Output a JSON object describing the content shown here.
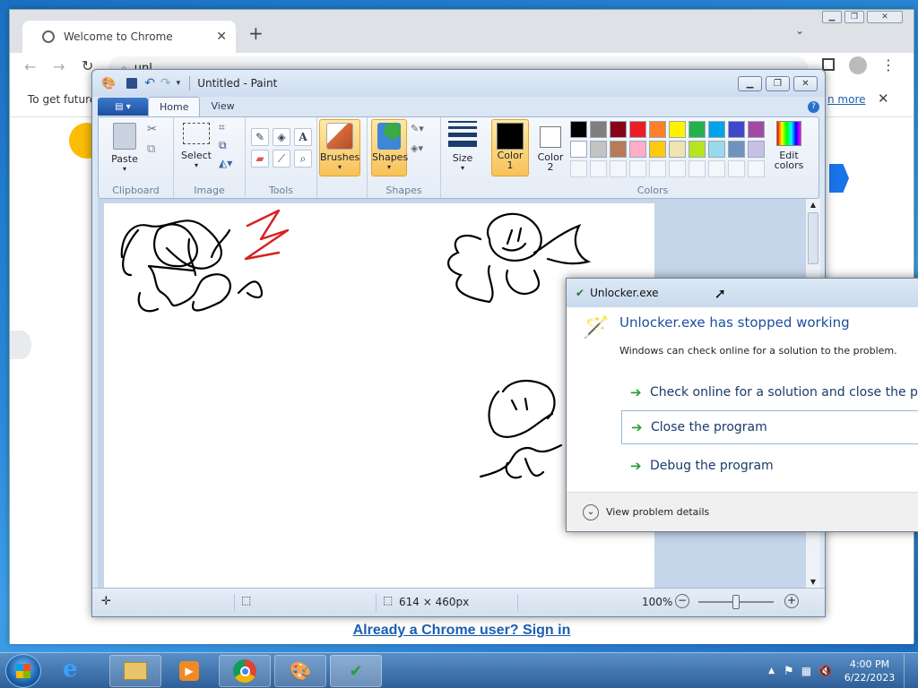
{
  "chrome": {
    "tab_title": "Welcome to Chrome",
    "omnibox_text": "unl",
    "info_text": "To get future",
    "info_link": "n more",
    "signin_link": "Already a Chrome user? Sign in"
  },
  "paint": {
    "title": "Untitled - Paint",
    "tabs": [
      "Home",
      "View"
    ],
    "groups": {
      "clipboard": "Clipboard",
      "image": "Image",
      "tools": "Tools",
      "shapes": "Shapes",
      "colors": "Colors"
    },
    "buttons": {
      "paste": "Paste",
      "select": "Select",
      "brushes": "Brushes",
      "shapes": "Shapes",
      "size": "Size",
      "color1_line1": "Color",
      "color1_line2": "1",
      "color2_line1": "Color",
      "color2_line2": "2",
      "edit_colors_line1": "Edit",
      "edit_colors_line2": "colors"
    },
    "color1": "#000000",
    "color2": "#ffffff",
    "palette": [
      "#000000",
      "#7f7f7f",
      "#880015",
      "#ed1c24",
      "#ff7f27",
      "#fff200",
      "#22b14c",
      "#00a2e8",
      "#3f48cc",
      "#a349a4",
      "#ffffff",
      "#c3c3c3",
      "#b97a57",
      "#ffaec9",
      "#ffc90e",
      "#efe4b0",
      "#b5e61d",
      "#99d9ea",
      "#7092be",
      "#c8bfe7"
    ],
    "status": {
      "dimensions": "614 × 460px",
      "zoom": "100%"
    }
  },
  "dialog": {
    "title": "Unlocker.exe",
    "heading": "Unlocker.exe has stopped working",
    "subtext": "Windows can check online for a solution to the problem.",
    "options": [
      "Check online for a solution and close the pr",
      "Close the program",
      "Debug the program"
    ],
    "details": "View problem details"
  },
  "taskbar": {
    "time": "4:00 PM",
    "date": "6/22/2023"
  }
}
